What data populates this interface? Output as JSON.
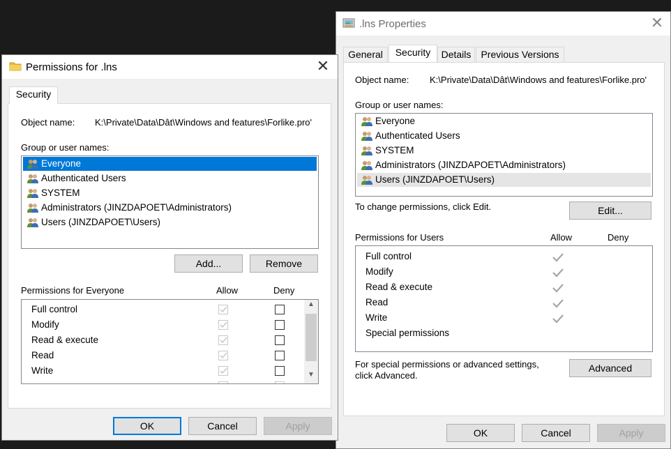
{
  "properties_dialog": {
    "title": ".lns Properties",
    "tabs": [
      {
        "label": "General"
      },
      {
        "label": "Security"
      },
      {
        "label": "Details"
      },
      {
        "label": "Previous Versions"
      }
    ],
    "object_name_label": "Object name:",
    "object_name_value": "K:\\Private\\Data\\Dât\\Windows and features\\Forlike.pro'",
    "group_label": "Group or user names:",
    "users": [
      {
        "label": "Everyone"
      },
      {
        "label": "Authenticated Users"
      },
      {
        "label": "SYSTEM"
      },
      {
        "label": "Administrators (JINZDAPOET\\Administrators)"
      },
      {
        "label": "Users (JINZDAPOET\\Users)"
      }
    ],
    "change_hint": "To change permissions, click Edit.",
    "edit_label": "Edit...",
    "permissions_for": "Permissions for Users",
    "allow_label": "Allow",
    "deny_label": "Deny",
    "permissions": [
      {
        "label": "Full control",
        "allow": true
      },
      {
        "label": "Modify",
        "allow": true
      },
      {
        "label": "Read & execute",
        "allow": true
      },
      {
        "label": "Read",
        "allow": true
      },
      {
        "label": "Write",
        "allow": true
      },
      {
        "label": "Special permissions",
        "allow": false
      }
    ],
    "advanced_hint_1": "For special permissions or advanced settings,",
    "advanced_hint_2": "click Advanced.",
    "advanced_label": "Advanced",
    "ok_label": "OK",
    "cancel_label": "Cancel",
    "apply_label": "Apply"
  },
  "permissions_dialog": {
    "title": "Permissions for .lns",
    "tab_label": "Security",
    "object_name_label": "Object name:",
    "object_name_value": "K:\\Private\\Data\\Dât\\Windows and features\\Forlike.pro'",
    "group_label": "Group or user names:",
    "users": [
      {
        "label": "Everyone"
      },
      {
        "label": "Authenticated Users"
      },
      {
        "label": "SYSTEM"
      },
      {
        "label": "Administrators (JINZDAPOET\\Administrators)"
      },
      {
        "label": "Users (JINZDAPOET\\Users)"
      }
    ],
    "add_label": "Add...",
    "remove_label": "Remove",
    "permissions_for": "Permissions for Everyone",
    "allow_label": "Allow",
    "deny_label": "Deny",
    "permissions": [
      {
        "label": "Full control"
      },
      {
        "label": "Modify"
      },
      {
        "label": "Read & execute"
      },
      {
        "label": "Read"
      },
      {
        "label": "Write"
      }
    ],
    "ok_label": "OK",
    "cancel_label": "Cancel",
    "apply_label": "Apply"
  },
  "colors": {
    "selection": "#0078d7",
    "dialog_bg": "#f0f0f0",
    "desktop": "#1b1b1b"
  },
  "icons": [
    "folder-icon",
    "properties-icon",
    "close-icon",
    "users-group-icon",
    "check-icon",
    "scroll-up-icon",
    "scroll-down-icon"
  ]
}
